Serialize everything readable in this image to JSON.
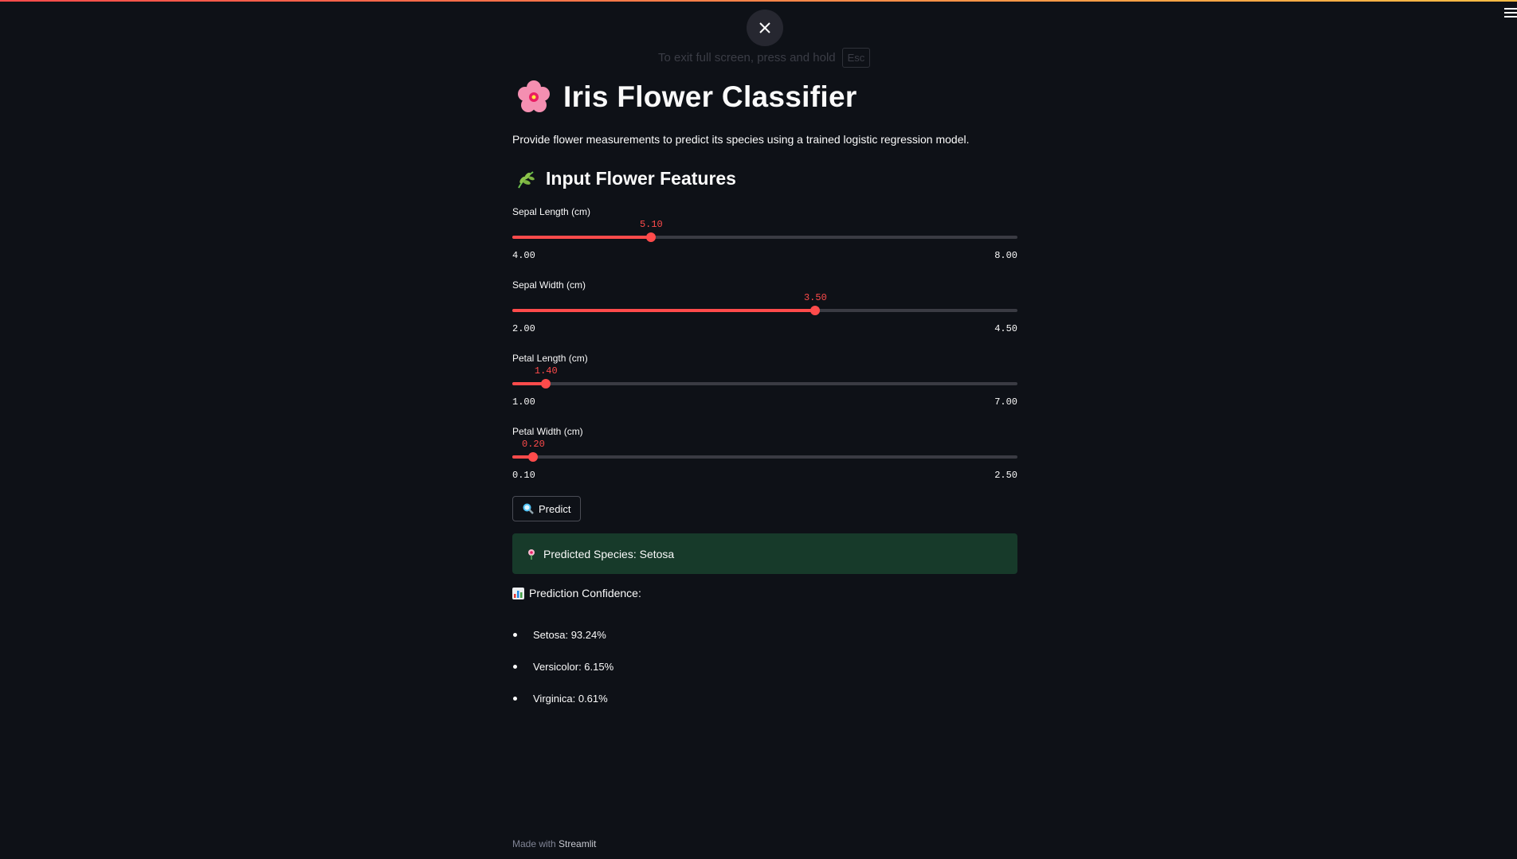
{
  "fullscreen": {
    "hint": "To exit full screen, press and hold",
    "key": "Esc"
  },
  "title": "Iris Flower Classifier",
  "description": "Provide flower measurements to predict its species using a trained logistic regression model.",
  "features_heading": "Input Flower Features",
  "sliders": [
    {
      "label": "Sepal Length (cm)",
      "value": "5.10",
      "min": "4.00",
      "max": "8.00",
      "fraction": 0.275
    },
    {
      "label": "Sepal Width (cm)",
      "value": "3.50",
      "min": "2.00",
      "max": "4.50",
      "fraction": 0.6
    },
    {
      "label": "Petal Length (cm)",
      "value": "1.40",
      "min": "1.00",
      "max": "7.00",
      "fraction": 0.0667
    },
    {
      "label": "Petal Width (cm)",
      "value": "0.20",
      "min": "0.10",
      "max": "2.50",
      "fraction": 0.0417
    }
  ],
  "predict_button": {
    "icon": "magnifier-icon",
    "label": "Predict"
  },
  "result": {
    "icon": "flower-icon",
    "text": "Predicted Species: Setosa"
  },
  "confidence": {
    "icon": "bar-chart-icon",
    "title": "Prediction Confidence:",
    "items": [
      "Setosa: 93.24%",
      "Versicolor: 6.15%",
      "Virginica: 0.61%"
    ]
  },
  "footer": {
    "prefix": "Made with",
    "brand": "Streamlit"
  },
  "colors": {
    "accent": "#ff4b4b",
    "background": "#0e1117",
    "success_bg": "#173a2a"
  }
}
